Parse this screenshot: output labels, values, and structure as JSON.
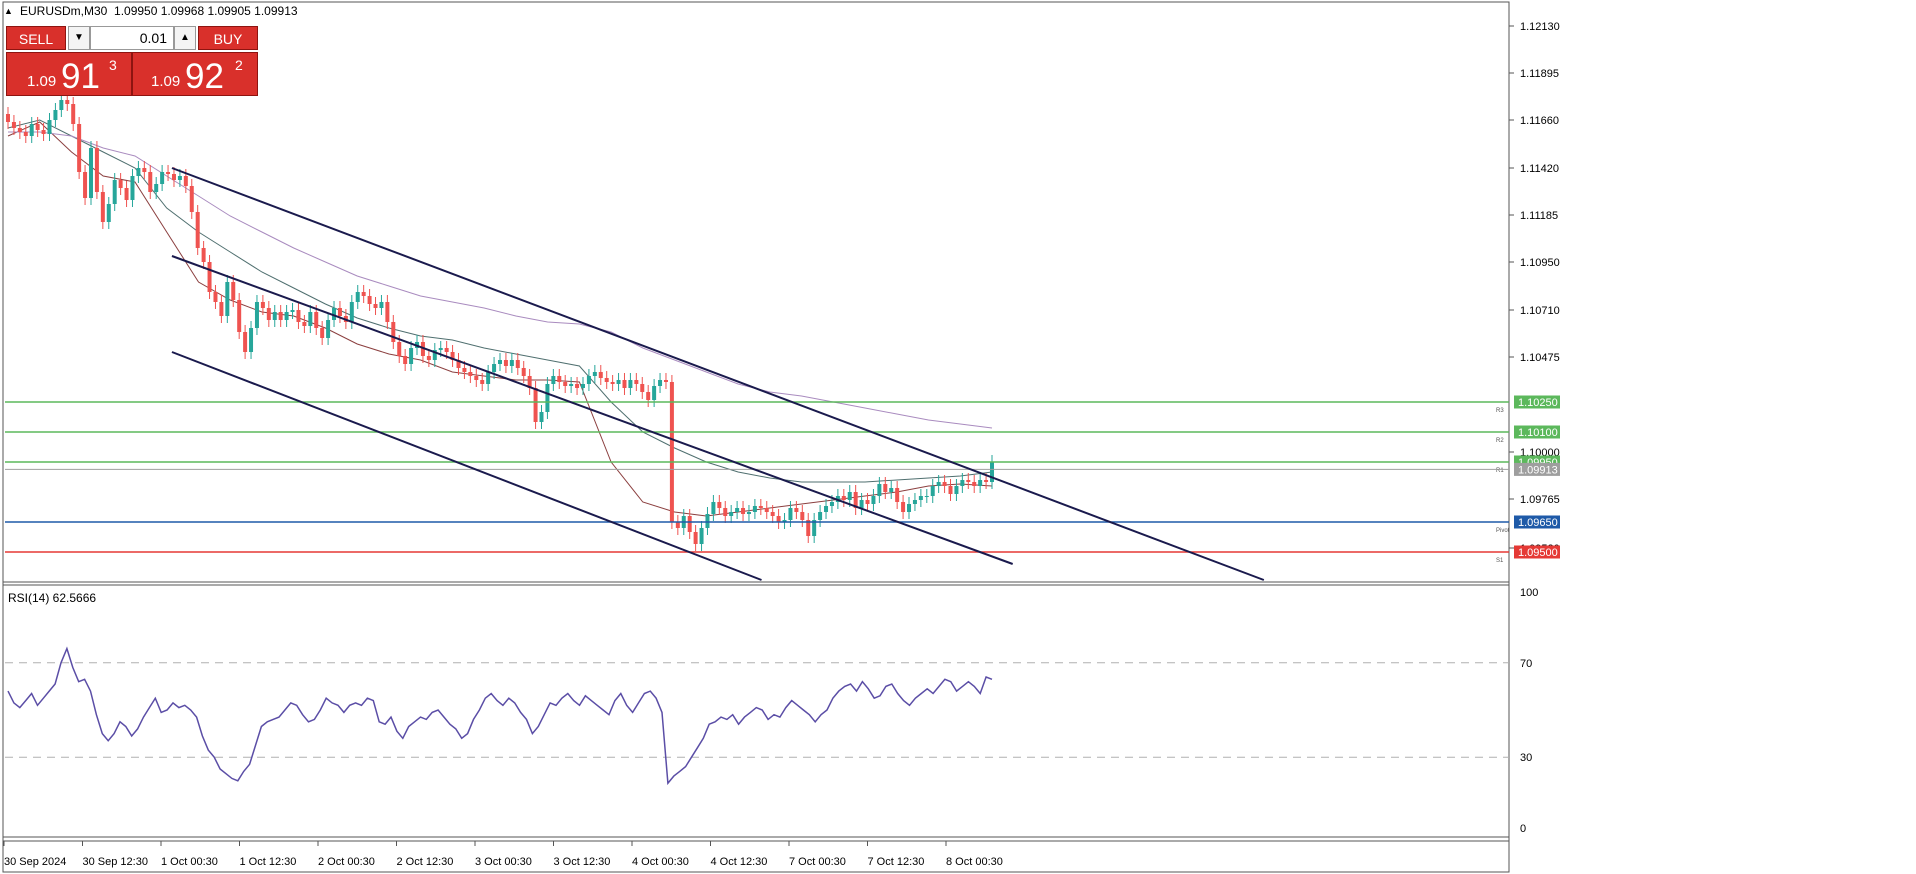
{
  "symbol": {
    "name": "EURUSDm,M30",
    "ohlc": "1.09950 1.09968 1.09905 1.09913"
  },
  "trade_panel": {
    "sell_label": "SELL",
    "buy_label": "BUY",
    "lot": "0.01",
    "sell_price": {
      "big": "1.09",
      "large": "91",
      "sup": "3"
    },
    "buy_price": {
      "big": "1.09",
      "large": "92",
      "sup": "2"
    }
  },
  "chart_data": [
    {
      "type": "line",
      "series_kind": "candlestick",
      "ylim": [
        1.0935,
        1.1225
      ],
      "y_ticks": [
        "1.12130",
        "1.11895",
        "1.11660",
        "1.11420",
        "1.11185",
        "1.10950",
        "1.10710",
        "1.10475",
        "1.10000",
        "1.09765",
        "1.09520"
      ],
      "y_tick_values": [
        1.1213,
        1.11895,
        1.1166,
        1.1142,
        1.11185,
        1.1095,
        1.1071,
        1.10475,
        1.1,
        1.09765,
        1.0952
      ],
      "x_ticks": [
        "30 Sep 2024",
        "30 Sep 12:30",
        "1 Oct 00:30",
        "1 Oct 12:30",
        "2 Oct 00:30",
        "2 Oct 12:30",
        "3 Oct 00:30",
        "3 Oct 12:30",
        "4 Oct 00:30",
        "4 Oct 12:30",
        "7 Oct 00:30",
        "7 Oct 12:30",
        "8 Oct 00:30"
      ],
      "series": [
        {
          "values": [
            1.1165,
            1.1162,
            1.116,
            1.1158,
            1.1164,
            1.1161,
            1.1159,
            1.1166,
            1.1171,
            1.1176,
            1.1174,
            1.1164,
            1.114,
            1.1127,
            1.1152,
            1.113,
            1.1115,
            1.1124,
            1.1136,
            1.1132,
            1.1126,
            1.1138,
            1.1142,
            1.114,
            1.113,
            1.1134,
            1.114,
            1.1139,
            1.1136,
            1.1138,
            1.1133,
            1.112,
            1.1102,
            1.1095,
            1.108,
            1.1075,
            1.1068,
            1.1085,
            1.1076,
            1.106,
            1.105,
            1.1062,
            1.1075,
            1.1072,
            1.1066,
            1.107,
            1.1066,
            1.107,
            1.1071,
            1.1065,
            1.1063,
            1.107,
            1.1062,
            1.1057,
            1.1066,
            1.1072,
            1.1068,
            1.1065,
            1.1075,
            1.108,
            1.1078,
            1.1074,
            1.1072,
            1.1075,
            1.1065,
            1.1055,
            1.1048,
            1.1044,
            1.1052,
            1.1055,
            1.1048,
            1.1046,
            1.1051,
            1.1052,
            1.105,
            1.1046,
            1.1042,
            1.104,
            1.1038,
            1.1036,
            1.1034,
            1.104,
            1.1044,
            1.1046,
            1.1043,
            1.1046,
            1.1042,
            1.1038,
            1.1032,
            1.1015,
            1.102,
            1.1034,
            1.1038,
            1.1035,
            1.1033,
            1.1034,
            1.1032,
            1.1034,
            1.1038,
            1.104,
            1.1037,
            1.1035,
            1.1034,
            1.1036,
            1.1032,
            1.1036,
            1.1034,
            1.103,
            1.1026,
            1.1033,
            1.1036,
            1.1035,
            1.0965,
            1.0962,
            1.0968,
            1.096,
            1.0954,
            1.0962,
            1.0969,
            1.0975,
            1.0972,
            1.0968,
            1.097,
            1.0972,
            1.0969,
            1.097,
            1.0973,
            1.0972,
            1.097,
            1.0968,
            1.0965,
            1.0966,
            1.0972,
            1.097,
            1.0966,
            1.0958,
            1.0966,
            1.097,
            1.0973,
            1.0975,
            1.0978,
            1.0976,
            1.098,
            1.0972,
            1.0976,
            1.0974,
            1.0978,
            1.0984,
            1.098,
            1.0982,
            1.0975,
            1.097,
            1.0974,
            1.0976,
            1.0978,
            1.0978,
            1.0983,
            1.0985,
            1.0983,
            1.0979,
            1.0983,
            1.0986,
            1.0985,
            1.0983,
            1.0986,
            1.0985,
            1.0995
          ]
        }
      ],
      "moving_averages": [
        {
          "color": "#8b3f3f",
          "values": [
            1.1158,
            1.1165,
            1.115,
            1.1138,
            1.1135,
            1.111,
            1.1085,
            1.1076,
            1.107,
            1.1068,
            1.1062,
            1.1054,
            1.1049,
            1.1046,
            1.104,
            1.1038,
            1.1036,
            1.1036,
            1.1035,
            1.0995,
            1.0975,
            1.097,
            1.0968,
            1.097,
            1.0972,
            1.0974,
            1.0976,
            1.0978,
            1.098,
            1.0983,
            1.0984,
            1.0983
          ]
        },
        {
          "color": "#4f6f6f",
          "values": [
            1.1162,
            1.1166,
            1.1158,
            1.115,
            1.1142,
            1.1122,
            1.111,
            1.11,
            1.109,
            1.1082,
            1.1074,
            1.1067,
            1.1062,
            1.1058,
            1.1056,
            1.1052,
            1.1049,
            1.1046,
            1.1043,
            1.1025,
            1.101,
            1.1002,
            1.0995,
            1.099,
            1.0987,
            1.0985,
            1.0985,
            1.0985,
            1.0986,
            1.0987,
            1.0988,
            1.099
          ]
        },
        {
          "color": "#a98bbf",
          "values": [
            1.116,
            1.116,
            1.1158,
            1.1152,
            1.1148,
            1.1138,
            1.1128,
            1.1118,
            1.111,
            1.1102,
            1.1095,
            1.1088,
            1.1083,
            1.1078,
            1.1075,
            1.1072,
            1.1068,
            1.1065,
            1.1064,
            1.106,
            1.1052,
            1.1046,
            1.104,
            1.1034,
            1.103,
            1.1028,
            1.1025,
            1.1022,
            1.1019,
            1.1016,
            1.1014,
            1.1012
          ]
        }
      ],
      "h_levels": [
        {
          "value": 1.1025,
          "label": "1.10250",
          "tag": "R3",
          "color": "#5cb85c"
        },
        {
          "value": 1.101,
          "label": "1.10100",
          "tag": "R2",
          "color": "#5cb85c"
        },
        {
          "value": 1.0995,
          "label": "1.09950",
          "tag": "R1",
          "color": "#5cb85c"
        },
        {
          "value": 1.09913,
          "label": "1.09913",
          "tag": "",
          "color": "#9e9e9e"
        },
        {
          "value": 1.0965,
          "label": "1.09650",
          "tag": "Pivot",
          "color": "#1e5aa8"
        },
        {
          "value": 1.095,
          "label": "1.09500",
          "tag": "S1",
          "color": "#e53935"
        }
      ],
      "channel_lines": [
        {
          "from": [
            1.1142,
            0.111
          ],
          "to": [
            1.0936,
            0.837
          ]
        },
        {
          "from": [
            1.1098,
            0.111
          ],
          "to": [
            1.0944,
            0.67
          ]
        },
        {
          "from": [
            1.105,
            0.111
          ],
          "to": [
            1.0936,
            0.503
          ]
        }
      ]
    },
    {
      "type": "line",
      "title": "RSI(14) 62.5666",
      "ylim": [
        0,
        100
      ],
      "y_ticks": [
        "100",
        "70",
        "30",
        "0"
      ],
      "levels": [
        70,
        30
      ],
      "series": [
        {
          "color": "#5b4ea6",
          "values": [
            58,
            53,
            51,
            54,
            57,
            52,
            55,
            58,
            61,
            70,
            76,
            68,
            62,
            63,
            58,
            48,
            40,
            37,
            40,
            45,
            43,
            39,
            42,
            47,
            51,
            55,
            49,
            50,
            53,
            51,
            52,
            50,
            47,
            39,
            33,
            30,
            25,
            23,
            21,
            20,
            24,
            27,
            35,
            43,
            45,
            46,
            47,
            50,
            53,
            52,
            48,
            45,
            46,
            50,
            55,
            53,
            52,
            49,
            52,
            53,
            52,
            55,
            54,
            45,
            44,
            47,
            41,
            38,
            43,
            45,
            47,
            46,
            49,
            50,
            47,
            44,
            42,
            38,
            40,
            46,
            50,
            55,
            57,
            54,
            52,
            55,
            53,
            49,
            46,
            40,
            43,
            48,
            53,
            52,
            55,
            57,
            54,
            52,
            56,
            54,
            52,
            50,
            48,
            54,
            57,
            52,
            49,
            53,
            57,
            58,
            55,
            49,
            19,
            22,
            24,
            26,
            30,
            34,
            38,
            44,
            45,
            47,
            46,
            48,
            44,
            47,
            49,
            51,
            50,
            46,
            48,
            47,
            51,
            54,
            52,
            50,
            48,
            45,
            48,
            50,
            55,
            58,
            60,
            61,
            58,
            62,
            59,
            55,
            56,
            60,
            61,
            57,
            54,
            52,
            55,
            57,
            59,
            57,
            60,
            63,
            62,
            58,
            60,
            62,
            60,
            57,
            64,
            63
          ]
        }
      ]
    }
  ]
}
